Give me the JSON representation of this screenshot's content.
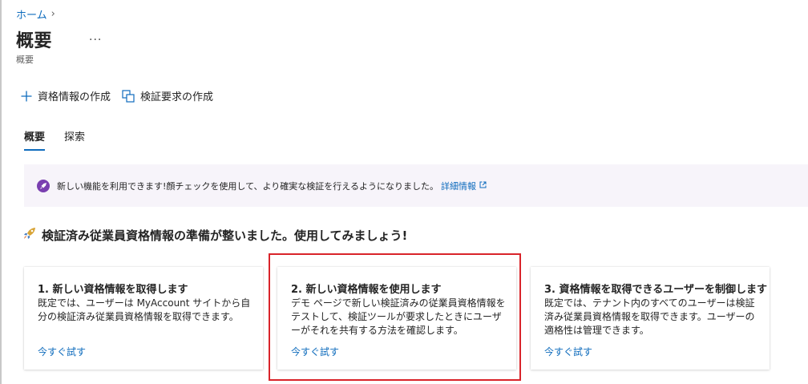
{
  "breadcrumb": {
    "home": "ホーム",
    "separator": "›"
  },
  "header": {
    "title": "概要",
    "more": "···",
    "subtitle": "概要"
  },
  "toolbar": {
    "create_credential": "資格情報の作成",
    "create_verification_request": "検証要求の作成"
  },
  "tabs": [
    {
      "label": "概要",
      "active": true
    },
    {
      "label": "探索",
      "active": false
    }
  ],
  "banner": {
    "text": "新しい機能を利用できます!顔チェックを使用して、より確実な検証を行えるようになりました。",
    "link": "詳細情報"
  },
  "section": {
    "heading": "検証済み従業員資格情報の準備が整いました。使用してみましょう!"
  },
  "cards": [
    {
      "title": "1. 新しい資格情報を取得します",
      "body": "既定では、ユーザーは MyAccount サイトから自分の検証済み従業員資格情報を取得できます。",
      "link": "今すぐ試す"
    },
    {
      "title": "2. 新しい資格情報を使用します",
      "body": "デモ ページで新しい検証済みの従業員資格情報をテストして、検証ツールが要求したときにユーザーがそれを共有する方法を確認します。",
      "link": "今すぐ試す"
    },
    {
      "title": "3. 資格情報を取得できるユーザーを制御します",
      "body": "既定では、テナント内のすべてのユーザーは検証済み従業員資格情報を取得できます。ユーザーの適格性は管理できます。",
      "link": "今すぐ試す"
    }
  ],
  "colors": {
    "accent": "#0f6cbd",
    "highlight": "#d9242a",
    "banner_bg": "#f7f4fa",
    "banner_icon": "#7a3fb0"
  }
}
